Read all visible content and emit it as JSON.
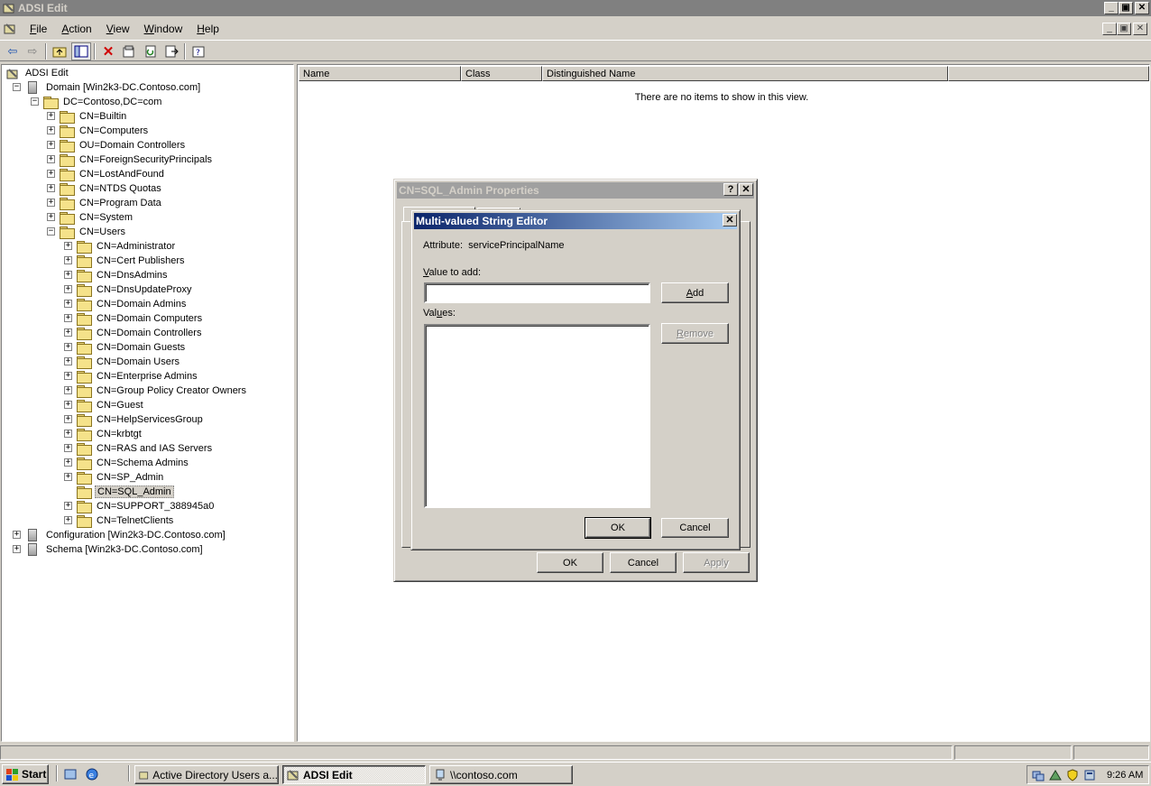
{
  "window": {
    "title": "ADSI Edit",
    "controls": {
      "minimize": "_",
      "maximize": "▣",
      "close": "✕"
    }
  },
  "menu": [
    {
      "label_underlined": "F",
      "label_rest": "ile"
    },
    {
      "label_underlined": "A",
      "label_rest": "ction"
    },
    {
      "label_underlined": "V",
      "label_rest": "iew"
    },
    {
      "label_underlined": "W",
      "label_rest": "indow"
    },
    {
      "label_underlined": "H",
      "label_rest": "elp"
    }
  ],
  "toolbar": {
    "icons": [
      "back-arrow-icon",
      "forward-arrow-icon",
      "up-folder-icon",
      "show-hide-tree-icon",
      "delete-icon",
      "properties-icon",
      "refresh-icon",
      "export-list-icon",
      "help-icon"
    ],
    "delete_glyph": "✕",
    "back_glyph": "⇦",
    "forward_glyph": "⇨"
  },
  "tree": {
    "root": "ADSI Edit",
    "domain": "Domain [Win2k3-DC.Contoso.com]",
    "dc": "DC=Contoso,DC=com",
    "containers": [
      "CN=Builtin",
      "CN=Computers",
      "OU=Domain Controllers",
      "CN=ForeignSecurityPrincipals",
      "CN=LostAndFound",
      "CN=NTDS Quotas",
      "CN=Program Data",
      "CN=System"
    ],
    "users": "CN=Users",
    "user_items": [
      "CN=Administrator",
      "CN=Cert Publishers",
      "CN=DnsAdmins",
      "CN=DnsUpdateProxy",
      "CN=Domain Admins",
      "CN=Domain Computers",
      "CN=Domain Controllers",
      "CN=Domain Guests",
      "CN=Domain Users",
      "CN=Enterprise Admins",
      "CN=Group Policy Creator Owners",
      "CN=Guest",
      "CN=HelpServicesGroup",
      "CN=krbtgt",
      "CN=RAS and IAS Servers",
      "CN=Schema Admins",
      "CN=SP_Admin",
      "CN=SQL_Admin",
      "CN=SUPPORT_388945a0",
      "CN=TelnetClients"
    ],
    "selected": "CN=SQL_Admin",
    "configuration": "Configuration [Win2k3-DC.Contoso.com]",
    "schema": "Schema [Win2k3-DC.Contoso.com]",
    "expand_glyph": "+",
    "collapse_glyph": "−"
  },
  "list": {
    "columns": [
      "Name",
      "Class",
      "Distinguished Name"
    ],
    "empty_message": "There are no items to show in this view."
  },
  "props_dialog": {
    "title": "CN=SQL_Admin Properties",
    "help": "?",
    "close": "✕",
    "ok": "OK",
    "cancel": "Cancel",
    "apply": "Apply"
  },
  "mv_dialog": {
    "title": "Multi-valued String Editor",
    "close": "✕",
    "attribute_label": "Attribute:",
    "attribute_value": "servicePrincipalName",
    "value_label_u": "V",
    "value_label_rest": "alue to add:",
    "value_input": "",
    "values_label_pre": "Val",
    "values_label_u": "u",
    "values_label_rest": "es:",
    "add_u": "A",
    "add_rest": "dd",
    "remove_u": "R",
    "remove_rest": "emove",
    "ok": "OK",
    "cancel": "Cancel"
  },
  "taskbar": {
    "start": "Start",
    "tasks": [
      "Active Directory Users a...",
      "ADSI Edit",
      "\\\\contoso.com"
    ],
    "active_task": "ADSI Edit",
    "clock": "9:26 AM",
    "colors": {
      "flag_red": "#e0401a",
      "flag_green": "#2aa02a",
      "flag_blue": "#1a50d0",
      "flag_yellow": "#f0c800"
    }
  }
}
